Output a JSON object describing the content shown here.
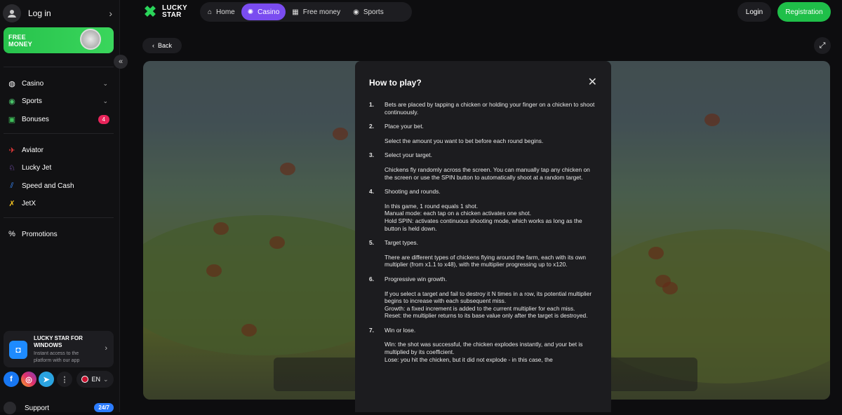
{
  "sidebar": {
    "login_label": "Log in",
    "promo_label": "FREE MONEY",
    "items_main": [
      {
        "label": "Casino",
        "icon": "globe-icon"
      },
      {
        "label": "Sports",
        "icon": "ball-icon"
      },
      {
        "label": "Bonuses",
        "icon": "gift-icon",
        "badge": "4"
      }
    ],
    "items_games": [
      {
        "label": "Aviator",
        "icon": "plane-icon"
      },
      {
        "label": "Lucky Jet",
        "icon": "jet-icon"
      },
      {
        "label": "Speed and Cash",
        "icon": "speed-icon"
      },
      {
        "label": "JetX",
        "icon": "x-icon"
      }
    ],
    "promotions_label": "Promotions",
    "windows_card": {
      "title": "LUCKY STAR FOR WINDOWS",
      "subtitle": "Instant access to the platform with our app"
    },
    "language": "EN",
    "support_label": "Support",
    "support_badge": "24/7"
  },
  "header": {
    "logo_line1": "LUCKY",
    "logo_line2": "STAR",
    "nav": [
      {
        "label": "Home",
        "icon": "home-icon",
        "active": false
      },
      {
        "label": "Casino",
        "icon": "casino-icon",
        "active": true
      },
      {
        "label": "Free money",
        "icon": "gift-icon",
        "active": false
      },
      {
        "label": "Sports",
        "icon": "ball-icon",
        "active": false
      }
    ],
    "login_button": "Login",
    "register_button": "Registration"
  },
  "content": {
    "back_label": "Back"
  },
  "modal": {
    "title": "How to play?",
    "steps": [
      {
        "num": "1.",
        "title": "Bets are placed by tapping a chicken or holding your finger on a chicken to shoot continuously.",
        "text": []
      },
      {
        "num": "2.",
        "title": "Place your bet.",
        "text": [
          "Select the amount you want to bet before each round begins."
        ]
      },
      {
        "num": "3.",
        "title": "Select your target.",
        "text": [
          "Chickens fly randomly across the screen. You can manually tap any chicken on the screen or use the SPIN button to automatically shoot at a random target."
        ]
      },
      {
        "num": "4.",
        "title": "Shooting and rounds.",
        "text": [
          "In this game, 1 round equals 1 shot.",
          "Manual mode: each tap on a chicken activates one shot.",
          "Hold SPIN: activates continuous shooting mode, which works as long as the button is held down."
        ]
      },
      {
        "num": "5.",
        "title": "Target types.",
        "text": [
          "There are different types of chickens flying around the farm, each with its own multiplier (from x1.1 to x48), with the multiplier progressing up to x120."
        ]
      },
      {
        "num": "6.",
        "title": "Progressive win growth.",
        "text": [
          "If you select a target and fail to destroy it N times in a row, its potential multiplier begins to increase with each subsequent miss.",
          "Growth: a fixed increment is added to the current multiplier for each miss.",
          "Reset: the multiplier returns to its base value only after the target is destroyed."
        ]
      },
      {
        "num": "7.",
        "title": "Win or lose.",
        "text": [
          "Win: the shot was successful, the chicken explodes instantly, and your bet is multiplied by its coefficient.",
          "Lose: you hit the chicken, but it did not explode - in this case, the"
        ]
      }
    ]
  }
}
